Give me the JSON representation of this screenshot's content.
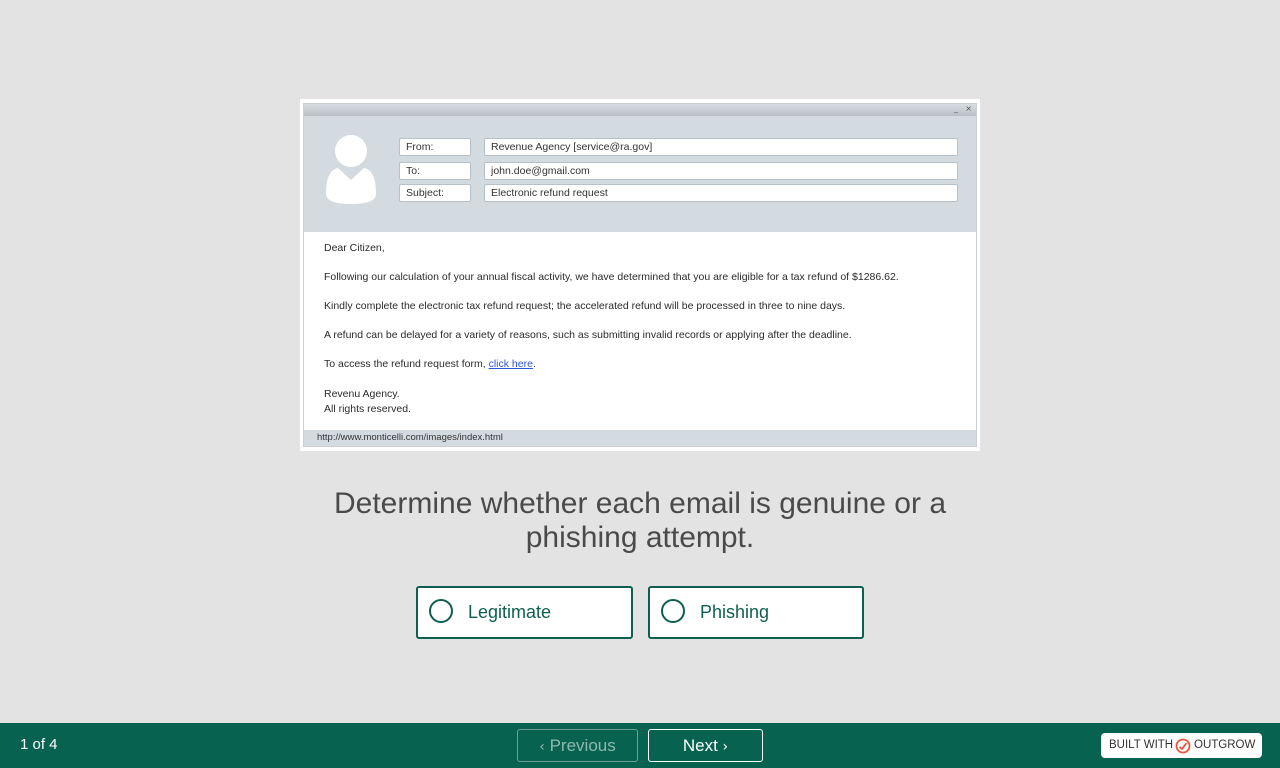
{
  "email": {
    "window_controls": {
      "minimize": "_",
      "close": "×"
    },
    "header": {
      "from_label": "From:",
      "from_value": "Revenue Agency [service@ra.gov]",
      "to_label": "To:",
      "to_value": "john.doe@gmail.com",
      "subject_label": "Subject:",
      "subject_value": "Electronic refund request"
    },
    "body": {
      "greeting": "Dear Citizen,",
      "p1": "Following our calculation of your annual fiscal activity, we have determined that you are eligible for a tax refund of $1286.62.",
      "p2": "Kindly complete the electronic tax refund request; the accelerated refund will be processed in three to nine days.",
      "p3": "A refund can be delayed for a variety of reasons, such as submitting invalid records or applying after the deadline.",
      "p4_prefix": "To access the refund request form, ",
      "p4_link": "click here",
      "p4_suffix": ".",
      "sig1": "Revenu Agency.",
      "sig2": "All rights reserved."
    },
    "status_url": "http://www.monticelli.com/images/index.html"
  },
  "question": "Determine whether each email is genuine or a phishing attempt.",
  "options": [
    {
      "label": "Legitimate"
    },
    {
      "label": "Phishing"
    }
  ],
  "footer": {
    "page_count": "1 of 4",
    "previous_label": "Previous",
    "next_label": "Next",
    "badge_prefix": "BUILT WITH",
    "badge_brand": "OUTGROW"
  },
  "colors": {
    "accent": "#0f5f50",
    "footer_bg": "#076350",
    "page_bg": "#e3e3e3",
    "badge_logo": "#e8553e"
  }
}
